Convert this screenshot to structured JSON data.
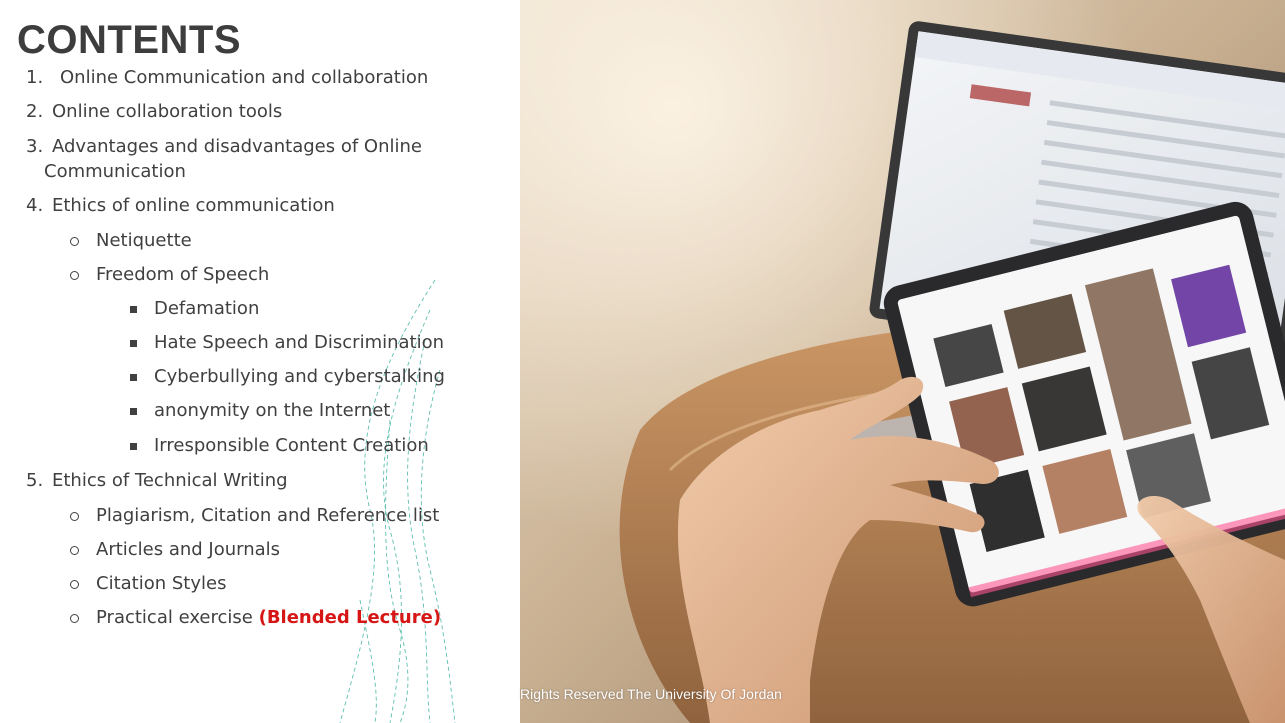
{
  "slide": {
    "title": "CONTENTS",
    "copyright": "Rights Reserved The University Of Jordan"
  },
  "toc": [
    {
      "marker": "1.",
      "text": "Online Communication and collaboration"
    },
    {
      "marker": "2.",
      "text": "Online collaboration tools"
    },
    {
      "marker": "3.",
      "text": "Advantages  and disadvantages of Online"
    },
    {
      "marker": "",
      "text": "Communication"
    },
    {
      "marker": "4.",
      "text": "Ethics of online communication"
    },
    {
      "marker": "o",
      "text": "Netiquette"
    },
    {
      "marker": "o",
      "text": "Freedom of Speech"
    },
    {
      "marker": "square",
      "text": "Defamation"
    },
    {
      "marker": "square",
      "text": "Hate Speech and Discrimination"
    },
    {
      "marker": "square",
      "text": "Cyberbullying and cyberstalking"
    },
    {
      "marker": "square",
      "text": "anonymity on the Internet"
    },
    {
      "marker": "square",
      "text": "Irresponsible Content Creation"
    },
    {
      "marker": "5.",
      "text": "Ethics of Technical Writing"
    },
    {
      "marker": "o",
      "text": "Plagiarism, Citation and Reference list"
    },
    {
      "marker": "o",
      "text": "Articles and Journals"
    },
    {
      "marker": "o",
      "text": "Citation Styles"
    },
    {
      "marker": "o",
      "text": "Practical exercise",
      "highlight": "(Blended Lecture)"
    }
  ],
  "colors": {
    "title": "#3d3d3d",
    "text": "#404040",
    "highlight": "#d61515",
    "deco": "#5fbfb0"
  },
  "icons": {
    "bullet_circle": "circle-bullet-icon",
    "bullet_square": "square-bullet-icon"
  }
}
